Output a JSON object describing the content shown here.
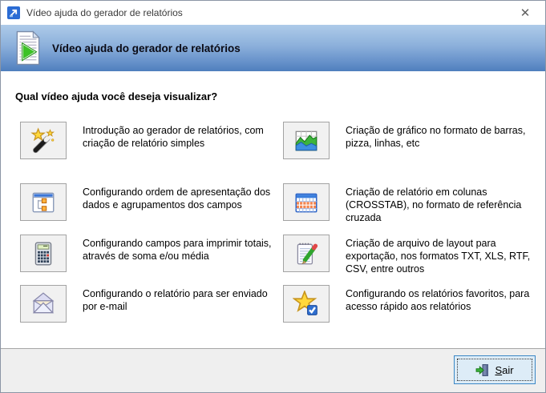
{
  "window": {
    "title": "Vídeo ajuda do gerador de relatórios",
    "close_glyph": "✕"
  },
  "header": {
    "title": "Vídeo ajuda do gerador de relatórios"
  },
  "main": {
    "question": "Qual vídeo ajuda você deseja visualizar?",
    "items": [
      {
        "icon": "wizard-wand-icon",
        "text": "Introdução ao gerador de relatórios, com criação de relatório simples"
      },
      {
        "icon": "grouping-tree-icon",
        "text": "Configurando ordem de apresentação dos dados e agrupamentos dos campos"
      },
      {
        "icon": "calculator-icon",
        "text": "Configurando campos para imprimir totais, através de soma e/ou média"
      },
      {
        "icon": "email-envelope-icon",
        "text": "Configurando o relatório para ser enviado por e-mail"
      },
      {
        "icon": "area-chart-icon",
        "text": "Criação de gráfico no formato de barras, pizza, linhas, etc"
      },
      {
        "icon": "crosstab-table-icon",
        "text": "Criação de relatório em colunas (CROSSTAB), no formato de referência cruzada"
      },
      {
        "icon": "layout-notepad-icon",
        "text": "Criação de arquivo de layout para exportação, nos formatos TXT, XLS, RTF, CSV, entre outros"
      },
      {
        "icon": "favorites-star-icon",
        "text": "Configurando os relatórios favoritos, para acesso rápido aos relatórios"
      }
    ]
  },
  "footer": {
    "exit_label": "Sair",
    "exit_key": "S",
    "exit_rest": "air"
  },
  "colors": {
    "header_gradient_top": "#aecbe9",
    "header_gradient_bottom": "#4f7fbd",
    "footer_bg": "#efefef",
    "icon_button_bg": "#f1f1f1",
    "exit_button_bg": "#ddecf7",
    "exit_button_border": "#3b87c5"
  }
}
